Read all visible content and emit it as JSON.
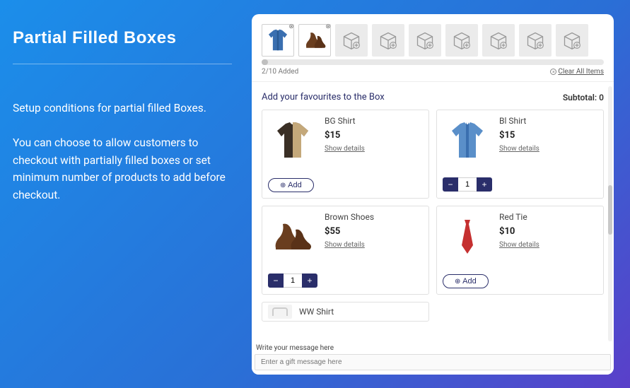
{
  "left": {
    "heading": "Partial Filled Boxes",
    "para1": "Setup conditions for partial filled Boxes.",
    "para2": "You can choose to allow customers to checkout with partially filled boxes or set minimum number of products to add before checkout."
  },
  "box": {
    "slots": 9,
    "filled": 2,
    "added_text": "2/10 Added",
    "clear_all": "Clear All Items"
  },
  "main": {
    "title": "Add your favourites to the Box",
    "subtotal_label": "Subtotal: ",
    "subtotal_value": "0",
    "show_details": "Show details",
    "add_label": "Add",
    "products": [
      {
        "name": "BG Shirt",
        "price": "$15",
        "mode": "add",
        "qty": 0,
        "icon": "bg-shirt"
      },
      {
        "name": "Bl Shirt",
        "price": "$15",
        "mode": "qty",
        "qty": 1,
        "icon": "bl-shirt"
      },
      {
        "name": "Brown Shoes",
        "price": "$55",
        "mode": "qty",
        "qty": 1,
        "icon": "shoes"
      },
      {
        "name": "Red Tie",
        "price": "$10",
        "mode": "add",
        "qty": 0,
        "icon": "tie"
      }
    ],
    "cut_product": {
      "name": "WW Shirt"
    }
  },
  "message": {
    "label": "Write your message here",
    "placeholder": "Enter a gift message here"
  },
  "colors": {
    "navy": "#2a2e6a"
  }
}
